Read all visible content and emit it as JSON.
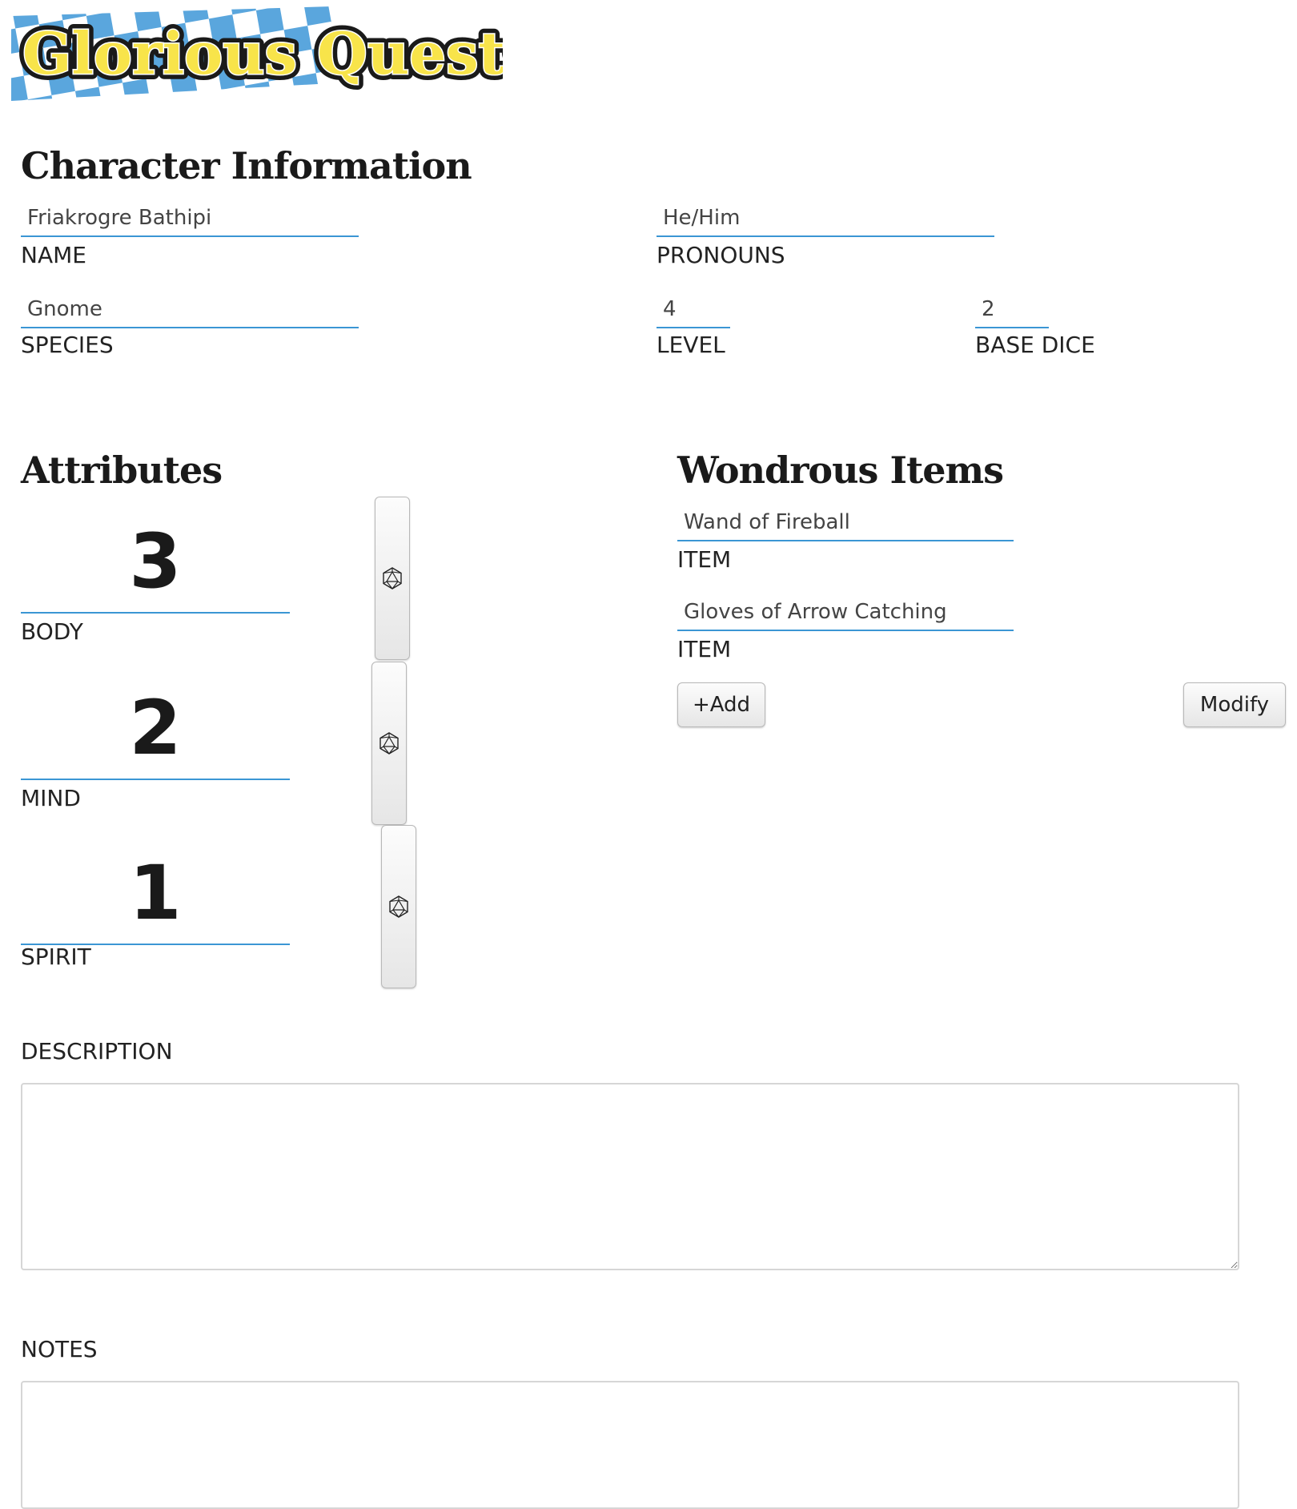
{
  "app": {
    "logo_text": "Glorious Quests"
  },
  "character_info": {
    "heading": "Character Information",
    "name": {
      "value": "Friakrogre Bathipi",
      "label": "NAME"
    },
    "pronouns": {
      "value": "He/Him",
      "label": "PRONOUNS"
    },
    "species": {
      "value": "Gnome",
      "label": "SPECIES"
    },
    "level": {
      "value": "4",
      "label": "LEVEL"
    },
    "base_dice": {
      "value": "2",
      "label": "BASE DICE"
    }
  },
  "attributes": {
    "heading": "Attributes",
    "items": [
      {
        "value": "3",
        "label": "BODY",
        "icon": "d20-icon"
      },
      {
        "value": "2",
        "label": "MIND",
        "icon": "d20-icon"
      },
      {
        "value": "1",
        "label": "SPIRIT",
        "icon": "d20-icon"
      }
    ]
  },
  "wondrous_items": {
    "heading": "Wondrous Items",
    "items": [
      {
        "value": "Wand of Fireball",
        "label": "ITEM"
      },
      {
        "value": "Gloves of Arrow Catching",
        "label": "ITEM"
      }
    ],
    "add_label": "+Add",
    "modify_label": "Modify"
  },
  "description": {
    "label": "DESCRIPTION",
    "value": ""
  },
  "notes": {
    "label": "NOTES",
    "value": ""
  },
  "colors": {
    "accent": "#3b96d4",
    "logo_fill": "#f8e44a",
    "logo_checker": "#5aa6dd"
  }
}
